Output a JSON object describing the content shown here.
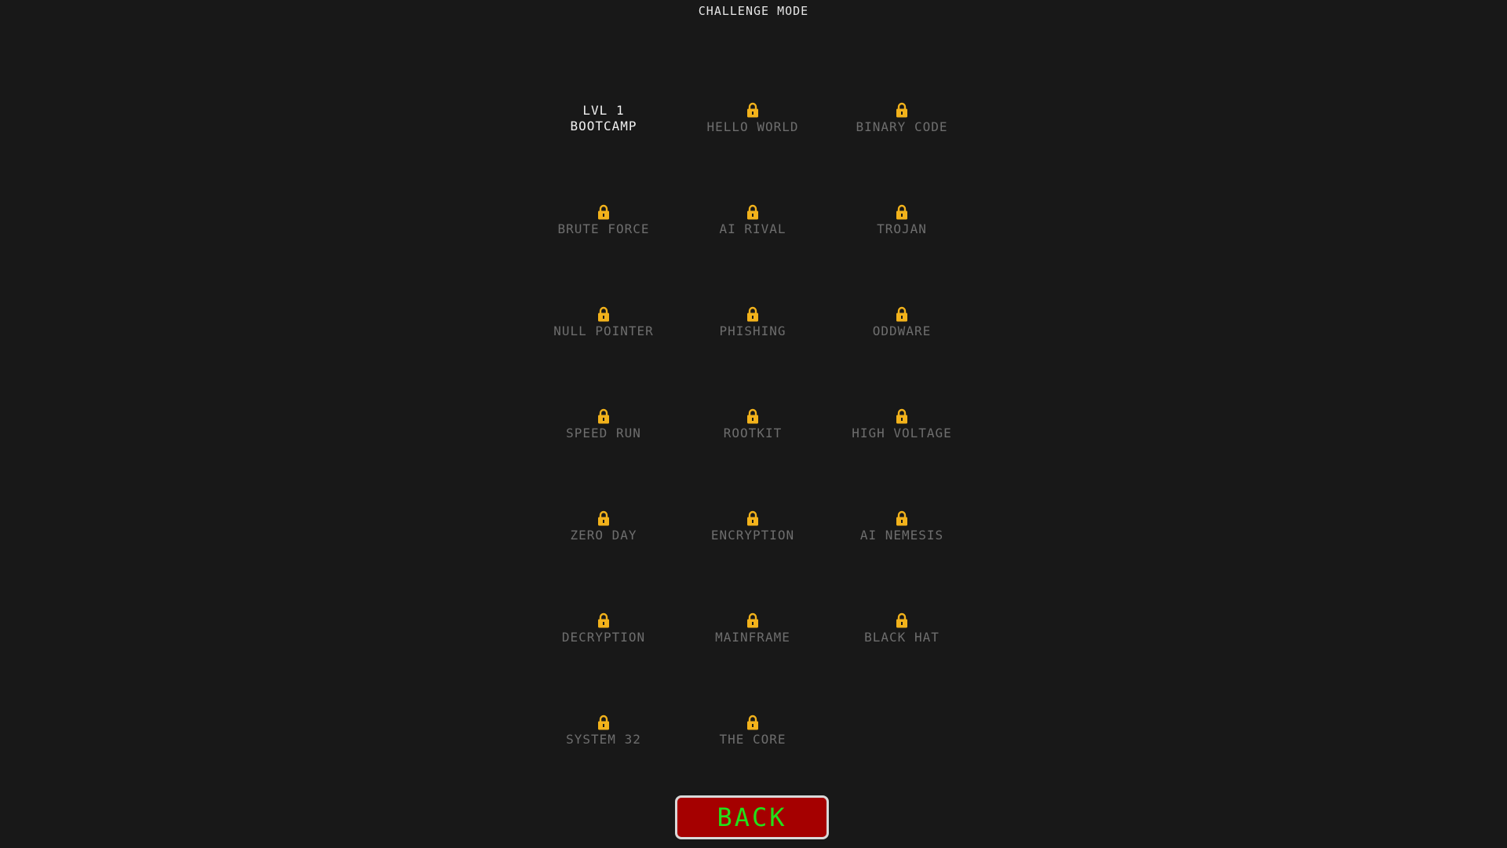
{
  "header": {
    "title": "CHALLENGE MODE"
  },
  "levels": [
    {
      "lvl": "LVL 1",
      "name": "BOOTCAMP",
      "locked": false
    },
    {
      "name": "HELLO WORLD",
      "locked": true
    },
    {
      "name": "BINARY CODE",
      "locked": true
    },
    {
      "name": "BRUTE FORCE",
      "locked": true
    },
    {
      "name": "AI RIVAL",
      "locked": true
    },
    {
      "name": "TROJAN",
      "locked": true
    },
    {
      "name": "NULL POINTER",
      "locked": true
    },
    {
      "name": "PHISHING",
      "locked": true
    },
    {
      "name": "ODDWARE",
      "locked": true
    },
    {
      "name": "SPEED RUN",
      "locked": true
    },
    {
      "name": "ROOTKIT",
      "locked": true
    },
    {
      "name": "HIGH VOLTAGE",
      "locked": true
    },
    {
      "name": "ZERO DAY",
      "locked": true
    },
    {
      "name": "ENCRYPTION",
      "locked": true
    },
    {
      "name": "AI NEMESIS",
      "locked": true
    },
    {
      "name": "DECRYPTION",
      "locked": true
    },
    {
      "name": "MAINFRAME",
      "locked": true
    },
    {
      "name": "BLACK HAT",
      "locked": true
    },
    {
      "name": "SYSTEM 32",
      "locked": true
    },
    {
      "name": "THE CORE",
      "locked": true
    }
  ],
  "lock_icon": "lock-icon",
  "colors": {
    "background": "#181818",
    "lock": "#f2b21b",
    "locked_text": "#6e6e6e",
    "unlocked_text": "#f0f0f0",
    "back_bg": "#a50000",
    "back_text": "#22e01a"
  },
  "footer": {
    "back_label": "BACK"
  }
}
